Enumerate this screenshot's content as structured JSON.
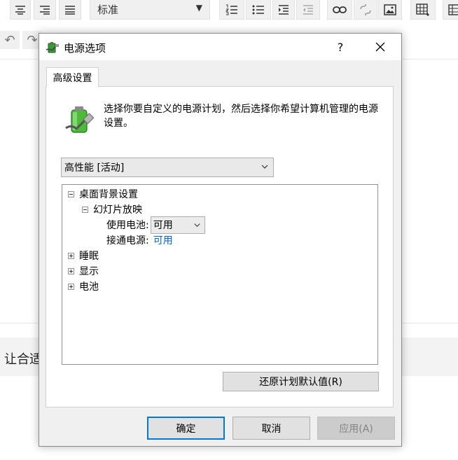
{
  "toolbar": {
    "style_value": "标准"
  },
  "background": {
    "peek_text": "让合适"
  },
  "dialog": {
    "title": "电源选项",
    "help_label": "?",
    "tab_label": "高级设置",
    "description": "选择你要自定义的电源计划，然后选择你希望计算机管理的电源设置。",
    "plan_value": "高性能 [活动]",
    "tree": {
      "desktop_bg": "桌面背景设置",
      "slideshow": "幻灯片放映",
      "on_battery_label": "使用电池:",
      "on_battery_value": "可用",
      "plugged_in_label": "接通电源:",
      "plugged_in_value": "可用",
      "sleep": "睡眠",
      "display": "显示",
      "battery": "电池"
    },
    "restore_label": "还原计划默认值(R)",
    "ok_label": "确定",
    "cancel_label": "取消",
    "apply_label": "应用(A)"
  },
  "colors": {
    "accent": "#0078d7",
    "link": "#0066cc"
  }
}
